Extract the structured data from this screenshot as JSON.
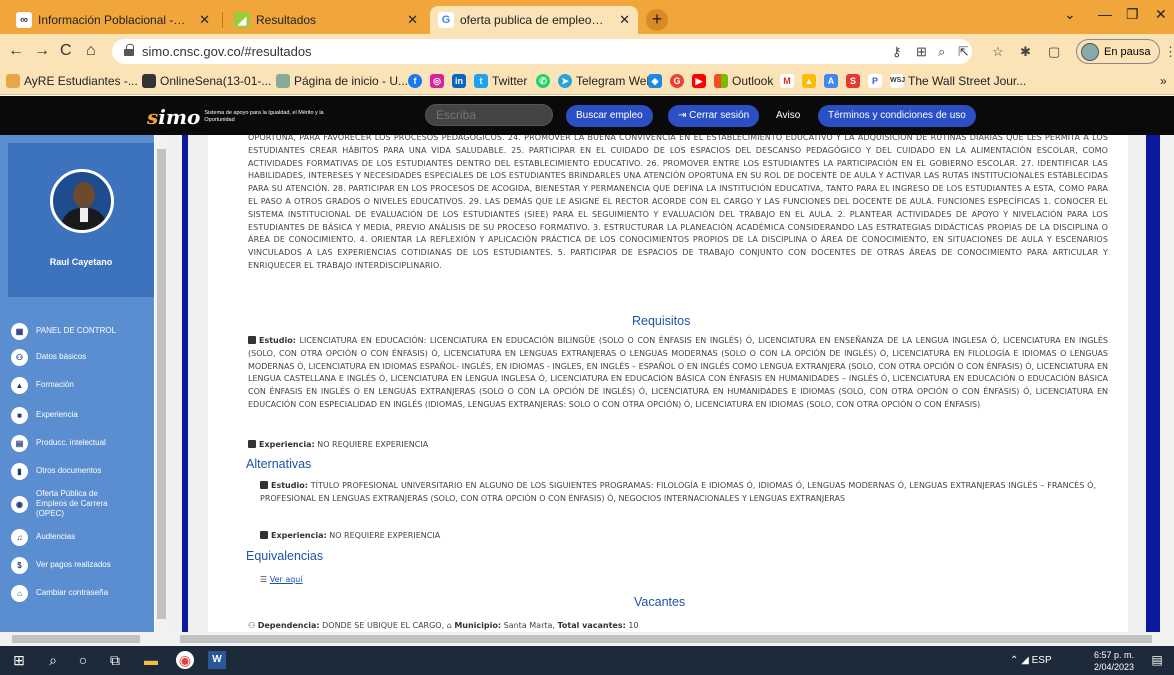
{
  "browser": {
    "tabs": [
      {
        "label": "Información Poblacional - SNIES",
        "favicon": "snies-icon",
        "active": false
      },
      {
        "label": "Resultados",
        "favicon": "simo-icon",
        "active": false
      },
      {
        "label": "oferta publica de empleos de car",
        "favicon": "google-icon",
        "active": true
      }
    ],
    "url": "simo.cnsc.gov.co/#resultados",
    "profile_label": "En pausa",
    "bookmarks": [
      "AyRE Estudiantes -...",
      "OnlineSena(13-01-...",
      "Página de inicio - U...",
      "Twitter",
      "Telegram Web",
      "Outlook",
      "The Wall Street Jour..."
    ]
  },
  "site": {
    "logo_text": "Sistema de apoyo para la Igualdad, el Mérito y la Oportunidad",
    "search_placeholder": "Escriba",
    "buscar": "Buscar empleo",
    "cerrar": "Cerrar sesión",
    "aviso": "Aviso",
    "terminos": "Términos y condiciones de uso"
  },
  "sidebar": {
    "user": "Raul Cayetano",
    "items": [
      {
        "label": "PANEL DE CONTROL",
        "icon": "dashboard-icon"
      },
      {
        "label": "Datos básicos",
        "icon": "users-icon"
      },
      {
        "label": "Formación",
        "icon": "graduation-icon"
      },
      {
        "label": "Experiencia",
        "icon": "briefcase-icon"
      },
      {
        "label": "Producc. intelectual",
        "icon": "book-icon"
      },
      {
        "label": "Otros documentos",
        "icon": "document-icon"
      },
      {
        "label": "Oferta Pública de Empleos de Carrera (OPEC)",
        "icon": "globe-icon"
      },
      {
        "label": "Audiencias",
        "icon": "audience-icon"
      },
      {
        "label": "Ver pagos realizados",
        "icon": "dollar-icon"
      },
      {
        "label": "Cambiar contraseña",
        "icon": "lock-icon"
      }
    ]
  },
  "content": {
    "funciones_text": "OPORTUNA, PARA FAVORECER LOS PROCESOS PEDAGÓGICOS. 24. PROMOVER LA BUENA CONVIVENCIA EN EL ESTABLECIMIENTO EDUCATIVO Y LA ADQUISICIÓN DE RUTINAS DIARIAS QUE LES PERMITA A LOS ESTUDIANTES CREAR HÁBITOS PARA UNA VIDA SALUDABLE. 25. PARTICIPAR EN EL CUIDADO DE LOS ESPACIOS DEL DESCANSO PEDAGÓGICO Y DEL CUIDADO EN LA ALIMENTACIÓN ESCOLAR, COMO ACTIVIDADES FORMATIVAS DE LOS ESTUDIANTES DENTRO DEL ESTABLECIMIENTO EDUCATIVO. 26. PROMOVER ENTRE LOS ESTUDIANTES LA PARTICIPACIÓN EN EL GOBIERNO ESCOLAR. 27. IDENTIFICAR LAS HABILIDADES, INTERESES Y NECESIDADES ESPECIALES DE LOS ESTUDIANTES BRINDARLES UNA ATENCIÓN OPORTUNA EN SU ROL DE DOCENTE DE AULA Y ACTIVAR LAS RUTAS INSTITUCIONALES ESTABLECIDAS PARA SU ATENCIÓN. 28. PARTICIPAR EN LOS PROCESOS DE ACOGIDA, BIENESTAR Y PERMANENCIA QUE DEFINA LA INSTITUCIÓN EDUCATIVA, TANTO PARA EL INGRESO DE LOS ESTUDIANTES A ESTA, COMO PARA EL PASO A OTROS GRADOS O NIVELES EDUCATIVOS. 29. LAS DEMÁS QUE LE ASIGNE EL RECTOR ACORDE CON EL CARGO Y LAS FUNCIONES DEL DOCENTE DE AULA. FUNCIONES ESPECÍFICAS 1. CONOCER EL SISTEMA INSTITUCIONAL DE EVALUACIÓN DE LOS ESTUDIANTES (SIEE) PARA EL SEGUIMIENTO Y EVALUACIÓN DEL TRABAJO EN EL AULA. 2. PLANTEAR ACTIVIDADES DE APOYO Y NIVELACIÓN PARA LOS ESTUDIANTES DE BÁSICA Y MEDIA, PREVIO ANÁLISIS DE SU PROCESO FORMATIVO. 3. ESTRUCTURAR LA PLANEACIÓN ACADÉMICA CONSIDERANDO LAS ESTRATEGIAS DIDÁCTICAS PROPIAS DE LA DISCIPLINA O ÁREA DE CONOCIMIENTO. 4. ORIENTAR LA REFLEXIÓN Y APLICACIÓN PRÁCTICA DE LOS CONOCIMIENTOS PROPIOS DE LA DISCIPLINA O ÁREA DE CONOCIMIENTO, EN SITUACIONES DE AULA Y ESCENARIOS VINCULADOS A LAS EXPERIENCIAS COTIDIANAS DE LOS ESTUDIANTES. 5. PARTICIPAR DE ESPACIOS DE TRABAJO CONJUNTO CON DOCENTES DE OTRAS ÁREAS DE CONOCIMIENTO PARA ARTICULAR Y ENRIQUECER EL TRABAJO INTERDISCIPLINARIO.",
    "requisitos_title": "Requisitos",
    "estudio_label": "Estudio:",
    "estudio_text": "LICENCIATURA EN EDUCACIÓN: LICENCIATURA EN EDUCACIÓN BILINGÜE (SOLO O CON ÉNFASIS EN INGLÉS) Ó, LICENCIATURA EN ENSEÑANZA DE LA LENGUA INGLESA Ó, LICENCIATURA EN INGLÉS (SOLO, CON OTRA OPCIÓN O CON ÉNFASIS) Ó, LICENCIATURA EN LENGUAS EXTRANJERAS O LENGUAS MODERNAS (SOLO O CON LA OPCIÓN DE INGLÉS) Ó, LICENCIATURA EN FILOLOGÍA E IDIOMAS O LENGUAS MODERNAS Ó, LICENCIATURA EN IDIOMAS ESPAÑOL- INGLÉS, EN IDIOMAS - INGLES, EN INGLÉS – ESPAÑOL O EN INGLÉS COMO LENGUA EXTRANJERA (SOLO, CON OTRA OPCIÓN O CON ÉNFASIS) Ó, LICENCIATURA EN LENGUA CASTELLANA E INGLÉS Ó, LICENCIATURA EN LENGUA INGLESA Ó, LICENCIATURA EN EDUCACIÓN BÁSICA CON ÉNFASIS EN HUMANIDADES – INGLÉS Ó, LICENCIATURA EN EDUCACIÓN O EDUCACIÓN BÁSICA CON ÉNFASIS EN INGLÉS O EN LENGUAS EXTRANJERAS (SOLO O CON LA OPCIÓN DE INGLÉS) Ó, LICENCIATURA EN HUMANIDADES E IDIOMAS (SOLO, CON OTRA OPCIÓN O CON ÉNFASIS) Ó, LICENCIATURA EN EDUCACIÓN CON ESPECIALIDAD EN INGLÉS (IDIOMAS, LENGUAS EXTRANJERAS: SOLO O CON OTRA OPCIÓN) Ó, LICENCIATURA EN IDIOMAS (SOLO, CON OTRA OPCIÓN O CON ÉNFASIS)",
    "experiencia_label": "Experiencia:",
    "experiencia_text": "NO REQUIERE EXPERIENCIA",
    "alternativas_title": "Alternativas",
    "alt_estudio_text": "TÍTULO PROFESIONAL UNIVERSITARIO EN ALGUNO DE LOS SIGUIENTES PROGRAMAS: FILOLOGÍA E IDIOMAS Ó, IDIOMAS Ó, LENGUAS MODERNAS Ó, LENGUAS EXTRANJERAS INGLÉS – FRANCÉS Ó, PROFESIONAL EN LENGUAS EXTRANJERAS (SOLO, CON OTRA OPCIÓN O CON ÉNFASIS) Ó, NEGOCIOS INTERNACIONALES Y LENGUAS EXTRANJERAS",
    "alt_experiencia_text": "NO REQUIERE EXPERIENCIA",
    "equivalencias_title": "Equivalencias",
    "ver_aqui": "Ver aquí",
    "vacantes_title": "Vacantes",
    "dependencia_label": "Dependencia:",
    "dependencia_text": "DONDE SE UBIQUE EL CARGO,",
    "municipio_label": "Municipio:",
    "municipio_text": "Santa Marta,",
    "total_label": "Total vacantes:",
    "total_value": "10"
  },
  "taskbar": {
    "lang": "ESP",
    "time": "6:57 p. m.",
    "date": "2/04/2023"
  }
}
